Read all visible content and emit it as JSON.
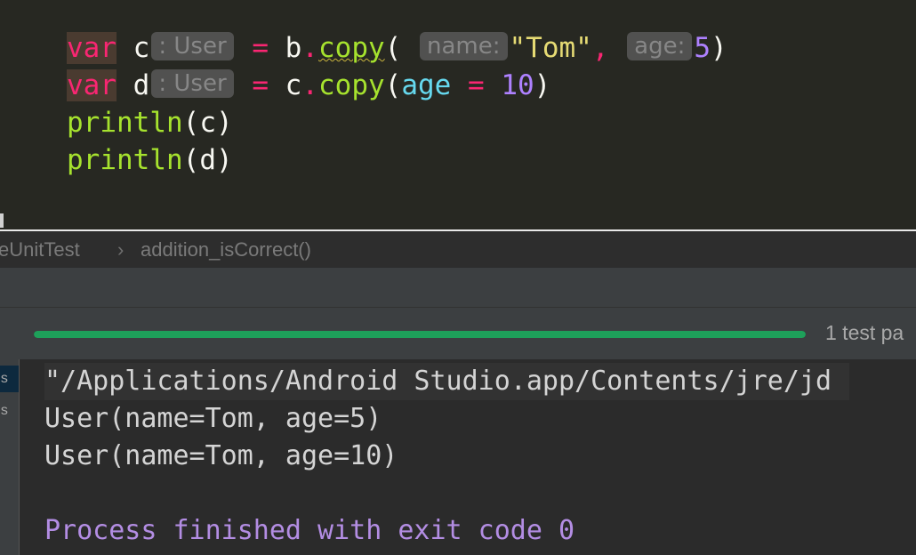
{
  "editor": {
    "lines": [
      {
        "keyword": "var",
        "var_name": "c",
        "type_hint": ": User",
        "assign": "=",
        "receiver": "b",
        "dot": ".",
        "method": "copy",
        "open_paren": "(",
        "arg1_hint": "name:",
        "arg1_value": "\"Tom\"",
        "comma": ",",
        "arg2_hint": "age:",
        "arg2_value": "5",
        "close_paren": ")"
      },
      {
        "keyword": "var",
        "var_name": "d",
        "type_hint": ": User",
        "assign": "=",
        "receiver": "c",
        "dot": ".",
        "method": "copy",
        "open_paren": "(",
        "named_param": "age",
        "named_eq": "=",
        "named_value": "10",
        "close_paren": ")"
      },
      {
        "func": "println",
        "open_paren": "(",
        "arg": "c",
        "close_paren": ")"
      },
      {
        "func": "println",
        "open_paren": "(",
        "arg": "d",
        "close_paren": ")"
      }
    ]
  },
  "breadcrumb": {
    "class_name": "eUnitTest",
    "separator": "›",
    "method_name": "addition_isCorrect()"
  },
  "run_panel": {
    "progress_fraction": 1.0,
    "progress_label": "1 test pa",
    "tree_items": [
      "ns",
      "ns"
    ]
  },
  "console": {
    "lines": [
      "\"/Applications/Android Studio.app/Contents/jre/jd",
      "User(name=Tom, age=5)",
      "User(name=Tom, age=10)",
      "Process finished with exit code 0"
    ]
  },
  "colors": {
    "keyword": "#f92672",
    "function": "#a6e22e",
    "string": "#e6db74",
    "number": "#ae81ff",
    "named_param": "#66d9ef",
    "progress_fill": "#1ea05a",
    "process_finished": "#b38de3"
  }
}
